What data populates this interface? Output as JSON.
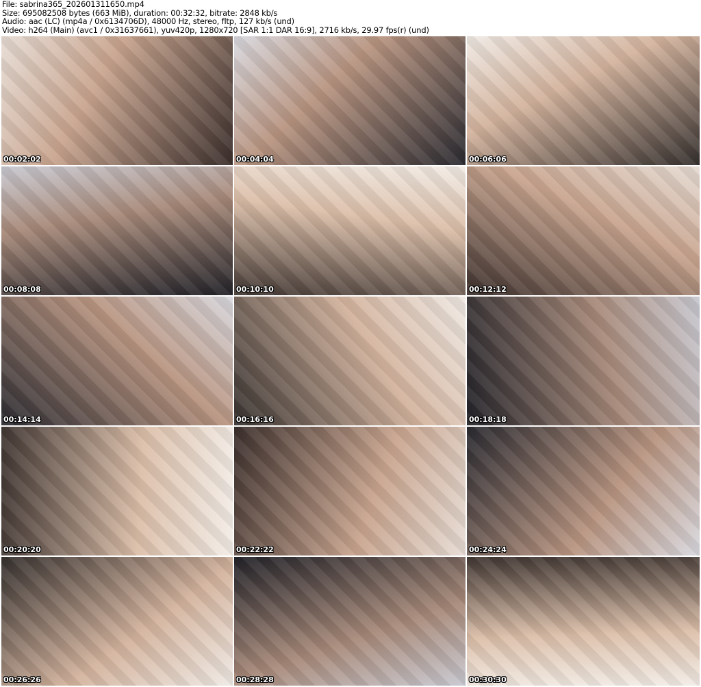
{
  "info": {
    "file": "File: sabrina365_202601311650.mp4",
    "size": "Size: 695082508 bytes (663 MiB), duration: 00:32:32, bitrate: 2848 kb/s",
    "audio": "Audio: aac (LC) (mp4a / 0x6134706D), 48000 Hz, stereo, fltp, 127 kb/s (und)",
    "video": "Video: h264 (Main) (avc1 / 0x31637661), yuv420p, 1280x720 [SAR 1:1 DAR 16:9], 2716 kb/s, 29.97 fps(r) (und)"
  },
  "thumbnails": [
    "00:02:02",
    "00:04:04",
    "00:06:06",
    "00:08:08",
    "00:10:10",
    "00:12:12",
    "00:14:14",
    "00:16:16",
    "00:18:18",
    "00:20:20",
    "00:22:22",
    "00:24:24",
    "00:26:26",
    "00:28:28",
    "00:30:30"
  ]
}
